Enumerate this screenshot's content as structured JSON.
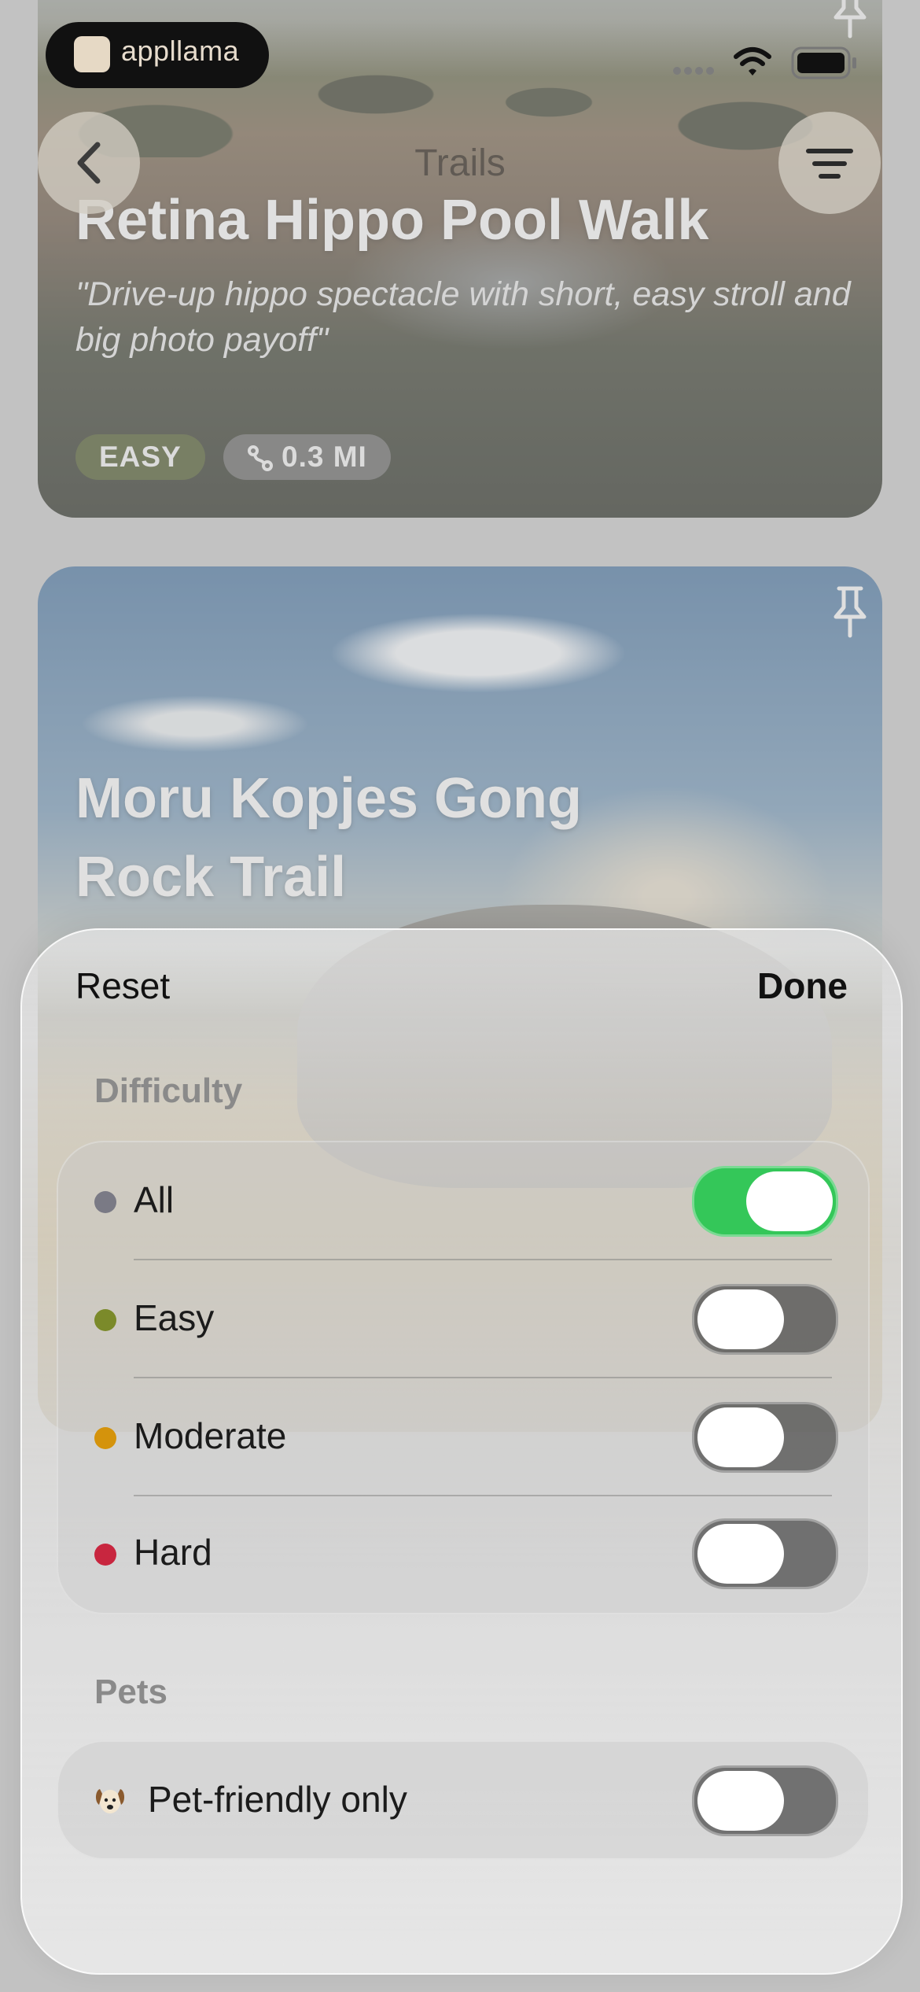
{
  "status_bar": {
    "app_name": "appllama"
  },
  "nav": {
    "title": "Trails"
  },
  "trails": [
    {
      "title": "Retina Hippo Pool Walk",
      "subtitle": "\"Drive-up hippo spectacle with short, easy stroll and big photo payoff\"",
      "difficulty": "EASY",
      "distance": "0.3 MI"
    },
    {
      "title": "Moru Kopjes Gong Rock Trail"
    }
  ],
  "filter_sheet": {
    "reset_label": "Reset",
    "done_label": "Done",
    "difficulty_section": "Difficulty",
    "difficulty_options": [
      {
        "label": "All",
        "dot_color": "#7a7a85",
        "enabled": true
      },
      {
        "label": "Easy",
        "dot_color": "#7b8a2a",
        "enabled": false
      },
      {
        "label": "Moderate",
        "dot_color": "#d4930c",
        "enabled": false
      },
      {
        "label": "Hard",
        "dot_color": "#c8263f",
        "enabled": false
      }
    ],
    "pets_section": "Pets",
    "pet_option": {
      "label": "Pet-friendly only",
      "icon": "dog-icon",
      "enabled": false
    }
  },
  "colors": {
    "toggle_on": "#34c759"
  }
}
